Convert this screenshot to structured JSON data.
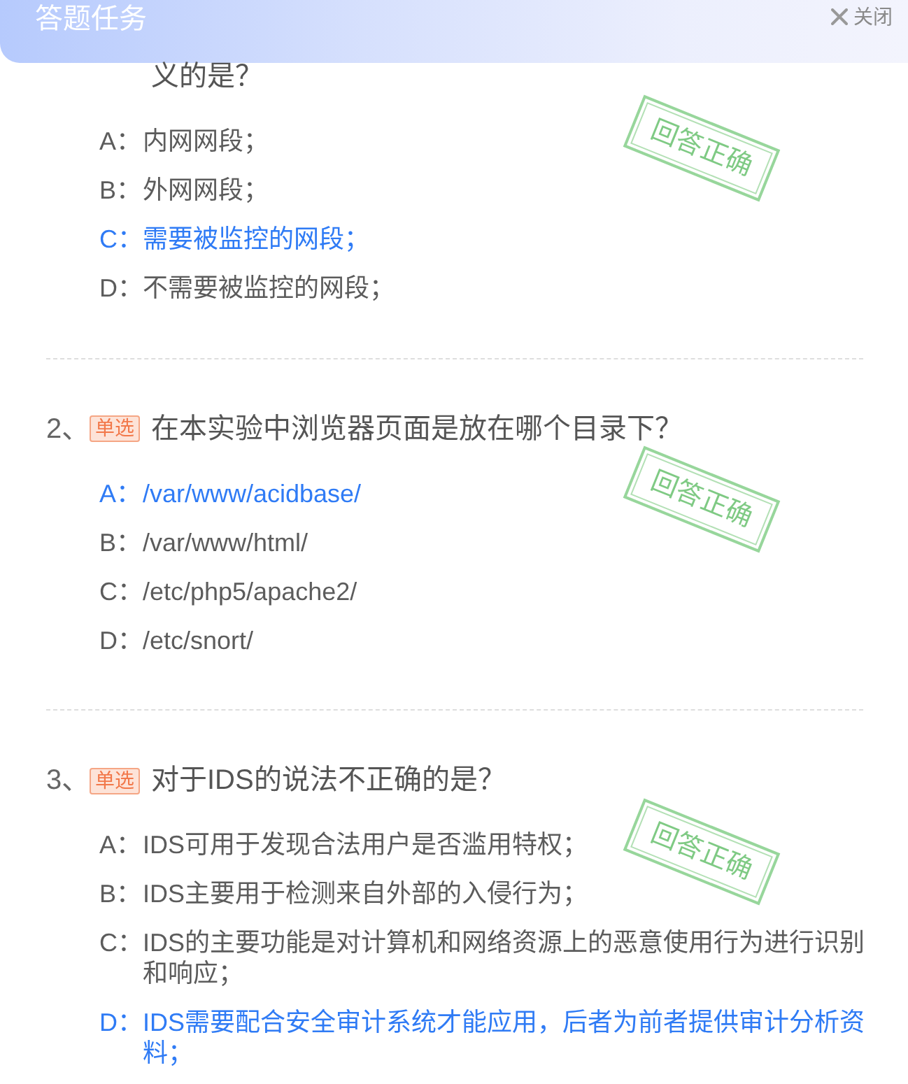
{
  "dialog": {
    "title": "答题任务",
    "close_label": "关闭"
  },
  "questions": [
    {
      "title": "义的是？",
      "stamp": "回答正确",
      "options": [
        {
          "letter": "A：",
          "text": "内网网段；",
          "selected": false
        },
        {
          "letter": "B：",
          "text": "外网网段；",
          "selected": false
        },
        {
          "letter": "C：",
          "text": "需要被监控的网段；",
          "selected": true
        },
        {
          "letter": "D：",
          "text": "不需要被监控的网段；",
          "selected": false
        }
      ]
    },
    {
      "number": "2、",
      "type_badge": "单选",
      "title": "在本实验中浏览器页面是放在哪个目录下？",
      "stamp": "回答正确",
      "options": [
        {
          "letter": "A：",
          "text": "/var/www/acidbase/",
          "selected": true
        },
        {
          "letter": "B：",
          "text": "/var/www/html/",
          "selected": false
        },
        {
          "letter": "C：",
          "text": "/etc/php5/apache2/",
          "selected": false
        },
        {
          "letter": "D：",
          "text": "/etc/snort/",
          "selected": false
        }
      ]
    },
    {
      "number": "3、",
      "type_badge": "单选",
      "title": "对于IDS的说法不正确的是？",
      "stamp": "回答正确",
      "options": [
        {
          "letter": "A：",
          "text": "IDS可用于发现合法用户是否滥用特权；",
          "selected": false
        },
        {
          "letter": "B：",
          "text": "IDS主要用于检测来自外部的入侵行为；",
          "selected": false
        },
        {
          "letter": "C：",
          "text": "IDS的主要功能是对计算机和网络资源上的恶意使用行为进行识别和响应；",
          "selected": false
        },
        {
          "letter": "D：",
          "text": "IDS需要配合安全审计系统才能应用，后者为前者提供审计分析资料；",
          "selected": true
        }
      ]
    }
  ]
}
